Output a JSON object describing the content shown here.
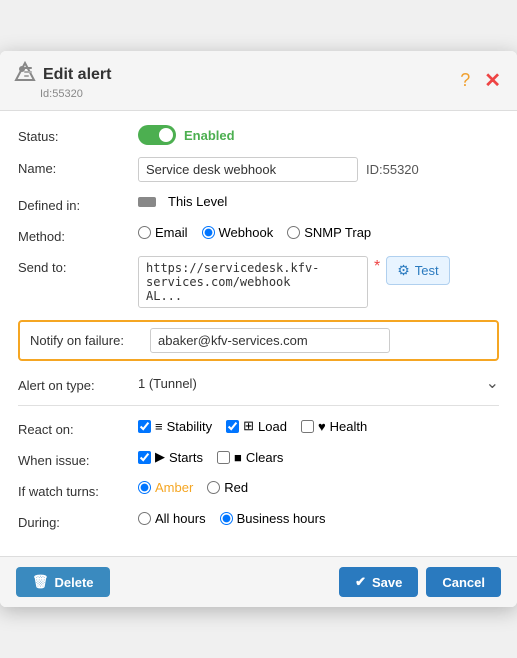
{
  "dialog": {
    "title": "Edit alert",
    "subtitle": "Id:55320",
    "help_icon": "?",
    "close_icon": "✕"
  },
  "status": {
    "label": "Status:",
    "value": "Enabled",
    "enabled": true
  },
  "name": {
    "label": "Name:",
    "value": "Service desk webhook",
    "id_label": "ID:55320"
  },
  "defined_in": {
    "label": "Defined in:",
    "value": "This Level"
  },
  "method": {
    "label": "Method:",
    "options": [
      "Email",
      "Webhook",
      "SNMP Trap"
    ],
    "selected": "Webhook"
  },
  "send_to": {
    "label": "Send to:",
    "value": "https://servicedesk.kfv-services.com/webhook\nAL...",
    "required": "*",
    "test_button": "Test"
  },
  "notify_on_failure": {
    "label": "Notify on failure:",
    "value": "abaker@kfv-services.com"
  },
  "alert_on_type": {
    "label": "Alert on type:",
    "value": "1 (Tunnel)"
  },
  "react_on": {
    "label": "React on:",
    "items": [
      {
        "label": "Stability",
        "checked": true,
        "icon": "≡"
      },
      {
        "label": "Load",
        "checked": true,
        "icon": "⊞"
      },
      {
        "label": "Health",
        "checked": false,
        "icon": "♥"
      }
    ]
  },
  "when_issue": {
    "label": "When issue:",
    "items": [
      {
        "label": "Starts",
        "checked": true,
        "icon": "▶"
      },
      {
        "label": "Clears",
        "checked": false,
        "icon": "■"
      }
    ]
  },
  "if_watch_turns": {
    "label": "If watch turns:",
    "options": [
      {
        "label": "Amber",
        "selected": true
      },
      {
        "label": "Red",
        "selected": false
      }
    ]
  },
  "during": {
    "label": "During:",
    "options": [
      {
        "label": "All hours",
        "selected": false
      },
      {
        "label": "Business hours",
        "selected": true
      }
    ]
  },
  "footer": {
    "delete_label": "Delete",
    "save_label": "Save",
    "cancel_label": "Cancel"
  }
}
